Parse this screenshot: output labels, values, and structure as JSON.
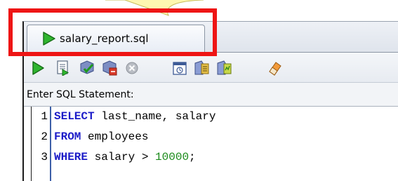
{
  "callout": {
    "color": "#fef7b0",
    "border": "#c8bd5a"
  },
  "window": {
    "tab": {
      "label": "salary_report.sql",
      "icon": "run-arrow-icon",
      "active": true
    }
  },
  "toolbar": {
    "buttons": [
      {
        "name": "run-statement-icon"
      },
      {
        "name": "run-script-icon"
      },
      {
        "name": "commit-icon"
      },
      {
        "name": "rollback-icon"
      },
      {
        "name": "cancel-icon"
      },
      {
        "name": "sql-tuning-advisor-icon"
      },
      {
        "name": "explain-plan-icon"
      },
      {
        "name": "autotrace-icon"
      },
      {
        "name": "clear-icon"
      }
    ]
  },
  "prompt": {
    "label": "Enter SQL Statement:"
  },
  "editor": {
    "lines": [
      {
        "number": "1",
        "keyword": "SELECT",
        "rest": " last_name, salary",
        "literal": ""
      },
      {
        "number": "2",
        "keyword": "FROM",
        "rest": " employees",
        "literal": ""
      },
      {
        "number": "3",
        "keyword": "WHERE",
        "rest": " salary > ",
        "literal": "10000",
        "tail": ";"
      }
    ]
  },
  "highlight": {
    "color": "#ee1515"
  },
  "colors": {
    "keyword": "#1c1cc8",
    "literal": "#1a8a1a",
    "gutter_line": "#3c5fa8"
  }
}
